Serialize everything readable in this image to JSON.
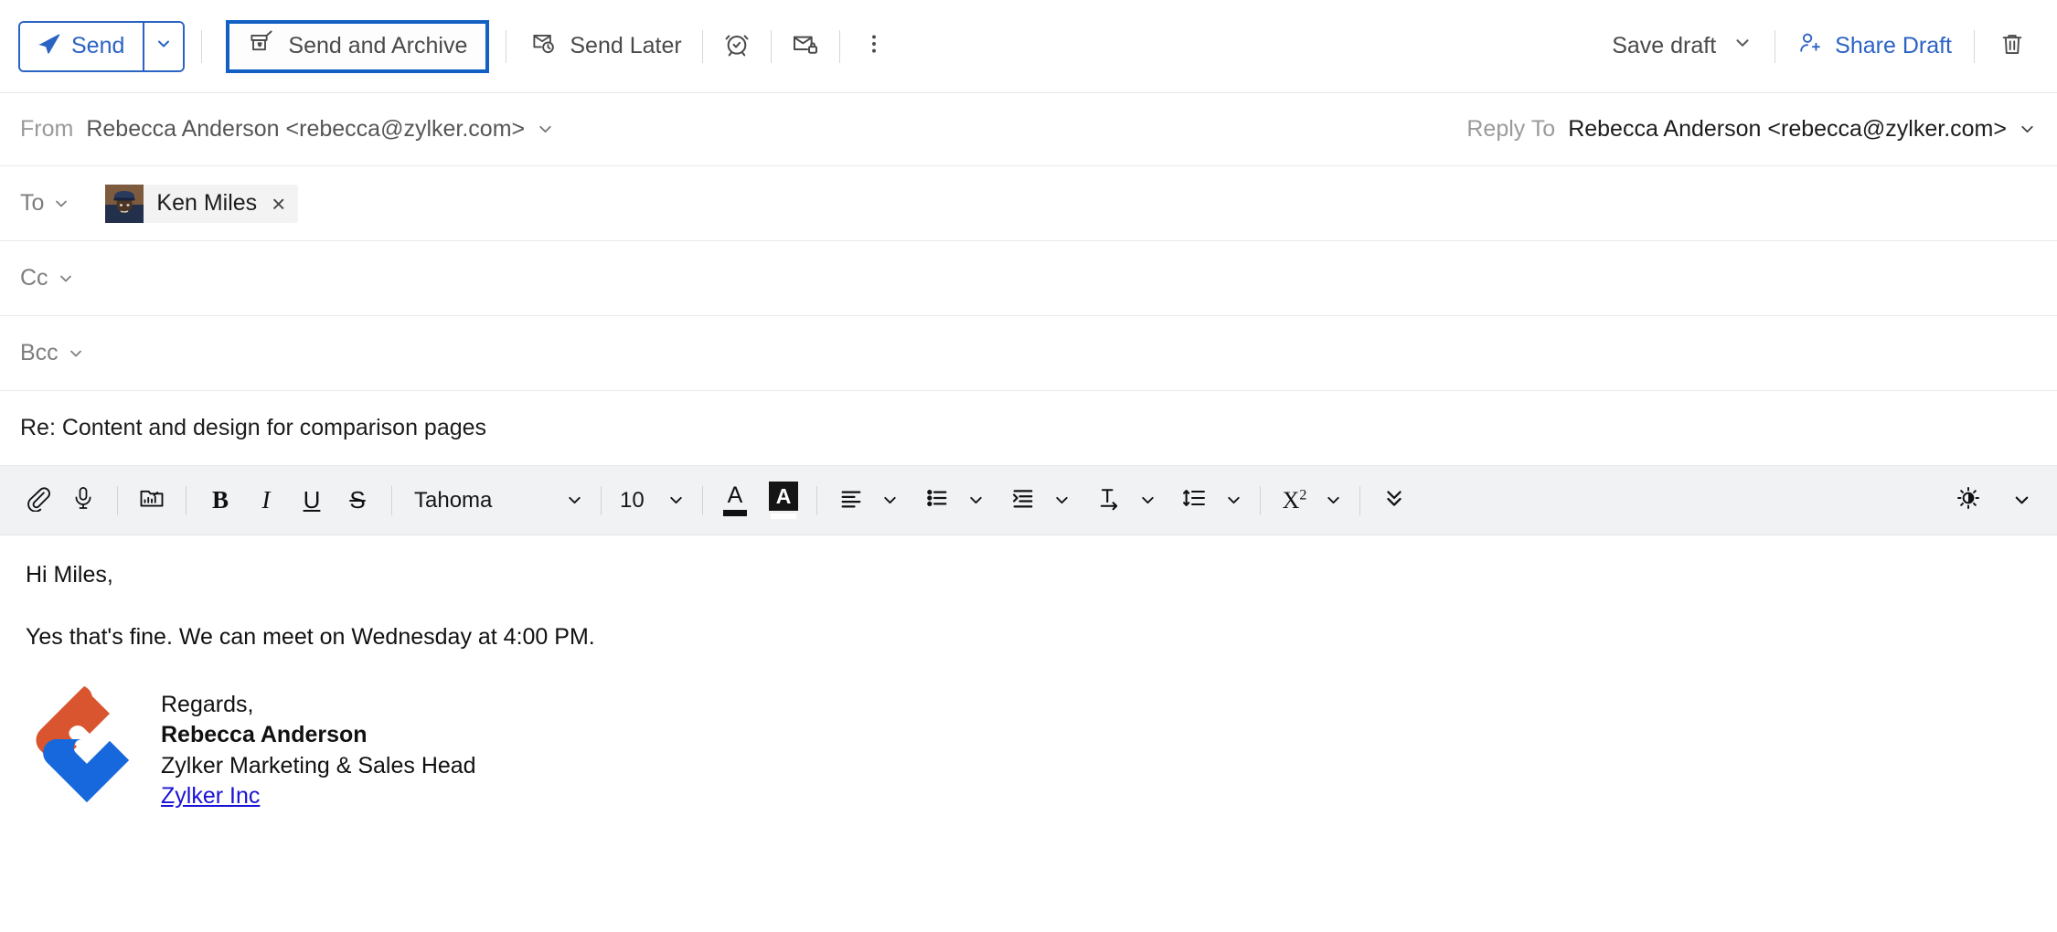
{
  "toolbar": {
    "send_label": "Send",
    "send_icon": "paper-plane-icon",
    "send_dropdown_icon": "chevron-down-icon",
    "send_and_archive_label": "Send and Archive",
    "send_and_archive_icon": "envelope-archive-icon",
    "send_later_label": "Send Later",
    "send_later_icon": "envelope-clock-icon",
    "reminder_icon": "alarm-clock-icon",
    "secure_mail_icon": "envelope-lock-icon",
    "more_options_icon": "more-vertical-icon",
    "save_draft_label": "Save draft",
    "save_draft_caret_icon": "chevron-down-icon",
    "share_draft_label": "Share Draft",
    "share_draft_icon": "person-add-icon",
    "delete_icon": "trash-icon",
    "accent_blue": "#2b63c4",
    "focus_border": "#1360c4"
  },
  "header": {
    "from_label": "From",
    "from_value": "Rebecca Anderson <rebecca@zylker.com>",
    "reply_to_label": "Reply To",
    "reply_to_value": "Rebecca Anderson <rebecca@zylker.com>",
    "to_label": "To",
    "to_recipients": [
      {
        "name": "Ken Miles",
        "remove_label": "×"
      }
    ],
    "cc_label": "Cc",
    "bcc_label": "Bcc",
    "subject": "Re: Content and design for comparison pages"
  },
  "format_toolbar": {
    "attach_icon": "paperclip-icon",
    "voice_icon": "microphone-icon",
    "insert_image_icon": "image-folder-icon",
    "bold_label": "B",
    "italic_label": "I",
    "underline_label": "U",
    "strikethrough_label": "S",
    "font_family": "Tahoma",
    "font_size": "10",
    "text_color_label": "A",
    "highlight_label": "A",
    "align_icon": "align-left-icon",
    "list_icon": "bullet-list-icon",
    "indent_icon": "indent-icon",
    "text_direction_icon": "text-direction-icon",
    "line_spacing_icon": "line-spacing-icon",
    "superscript_label": "X",
    "superscript_sup": "2",
    "more_formats_icon": "double-chevron-down-icon",
    "theme_icon": "brightness-icon",
    "collapse_icon": "chevron-down-icon"
  },
  "body": {
    "greeting": "Hi Miles,",
    "paragraph": "Yes that's fine. We can meet on Wednesday at 4:00 PM.",
    "signature": {
      "logo_icon": "zylker-logo-icon",
      "logo_orange": "#d9552f",
      "logo_blue": "#1668dc",
      "closing": "Regards,",
      "name": "Rebecca Anderson",
      "title": "Zylker Marketing & Sales Head",
      "company_link": "Zylker Inc"
    }
  }
}
